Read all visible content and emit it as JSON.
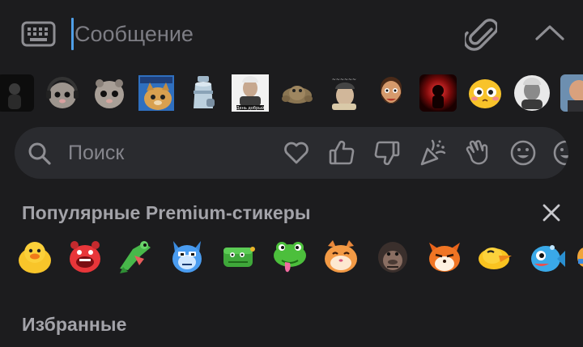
{
  "input_bar": {
    "placeholder": "Сообщение",
    "left_icon": "keyboard-icon",
    "attach_icon": "paperclip-icon",
    "expand_icon": "chevron-up-icon",
    "cursor_color": "#4f9fe8"
  },
  "sticker_packs": [
    {
      "icon": "dark-figure-pack"
    },
    {
      "icon": "hamster-headphones-pack"
    },
    {
      "icon": "hamster-pack"
    },
    {
      "icon": "cat-pack"
    },
    {
      "icon": "milk-can-pack"
    },
    {
      "icon": "old-man-pack"
    },
    {
      "icon": "crab-pack"
    },
    {
      "icon": "meme-man-pack"
    },
    {
      "icon": "bearded-man-pack"
    },
    {
      "icon": "red-glow-pack"
    },
    {
      "icon": "blushing-face-pack"
    },
    {
      "icon": "grey-portrait-pack"
    },
    {
      "icon": "bald-man-pack"
    }
  ],
  "search": {
    "placeholder": "Поиск",
    "icon": "search-icon",
    "emoji_filters": [
      "heart-icon",
      "thumbs-up-icon",
      "thumbs-down-icon",
      "party-popper-icon",
      "waving-hand-icon",
      "smile-icon",
      "smile-icon"
    ]
  },
  "sections": {
    "premium_title": "Популярные Premium-стикеры",
    "favorites_title": "Избранные"
  },
  "premium_stickers": [
    "duck-sticker",
    "red-monster-sticker",
    "green-frog-sticker",
    "blue-cat-sticker",
    "green-dino-sticker",
    "frog-tongue-sticker",
    "orange-cat-sticker",
    "gorilla-sticker",
    "fox-sticker",
    "yellow-duck-sticker",
    "fish-sticker",
    "partial-sticker"
  ],
  "colors": {
    "background": "#1c1c1e",
    "search_bg": "#2a2b2f",
    "icon_grey": "#8e8e93",
    "section_title": "#a3a3a9"
  }
}
